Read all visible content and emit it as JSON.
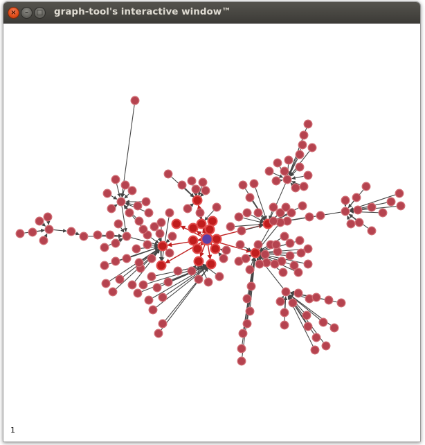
{
  "window": {
    "title": "graph-tool's interactive window™",
    "close_glyph": "×",
    "minimize_glyph": "–",
    "maximize_glyph": "□"
  },
  "canvas": {
    "label": "1"
  },
  "colors": {
    "node_fill": "#b5434f",
    "node_stroke": "#cf6b72",
    "highlight_fill": "#c01d1d",
    "highlight_stroke": "#e24c4c",
    "selected_fill": "#5b3fa8",
    "edge": "#444444",
    "highlight_edge": "#c02020",
    "titlebar": "#3c3b37"
  }
}
